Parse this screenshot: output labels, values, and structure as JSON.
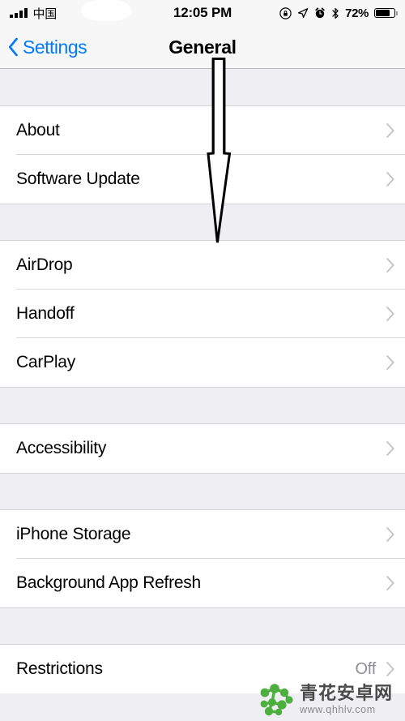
{
  "status_bar": {
    "carrier": "中国",
    "signal_icon": "signal-bars-icon",
    "wifi_icon": "wifi-icon",
    "time": "12:05 PM",
    "rotation_lock_icon": "rotation-lock-icon",
    "location_icon": "location-arrow-icon",
    "alarm_icon": "alarm-clock-icon",
    "bluetooth_icon": "bluetooth-icon",
    "battery_percent": "72%",
    "battery_level": 72
  },
  "nav_bar": {
    "back_label": "Settings",
    "back_icon": "chevron-left-icon",
    "title": "General"
  },
  "sections": [
    {
      "rows": [
        {
          "label": "About",
          "value": "",
          "accessory": "chevron-right-icon"
        },
        {
          "label": "Software Update",
          "value": "",
          "accessory": "chevron-right-icon"
        }
      ]
    },
    {
      "rows": [
        {
          "label": "AirDrop",
          "value": "",
          "accessory": "chevron-right-icon"
        },
        {
          "label": "Handoff",
          "value": "",
          "accessory": "chevron-right-icon"
        },
        {
          "label": "CarPlay",
          "value": "",
          "accessory": "chevron-right-icon"
        }
      ]
    },
    {
      "rows": [
        {
          "label": "Accessibility",
          "value": "",
          "accessory": "chevron-right-icon"
        }
      ]
    },
    {
      "rows": [
        {
          "label": "iPhone Storage",
          "value": "",
          "accessory": "chevron-right-icon"
        },
        {
          "label": "Background App Refresh",
          "value": "",
          "accessory": "chevron-right-icon"
        }
      ]
    },
    {
      "rows": [
        {
          "label": "Restrictions",
          "value": "Off",
          "accessory": "chevron-right-icon"
        }
      ]
    }
  ],
  "annotation": {
    "type": "down-arrow",
    "stroke_color": "#000000",
    "fill_color": "#FFFFFF"
  },
  "watermark": {
    "site_name": "青花安卓网",
    "url": "www.qhhlv.com",
    "logo_color": "#4CAF3E"
  },
  "colors": {
    "accent": "#007AFF",
    "group_background": "#EFEEF3",
    "row_background": "#FFFFFF",
    "separator": "#D8D7DB",
    "value_text": "#8E8E93",
    "chevron": "#C4C4C7"
  }
}
